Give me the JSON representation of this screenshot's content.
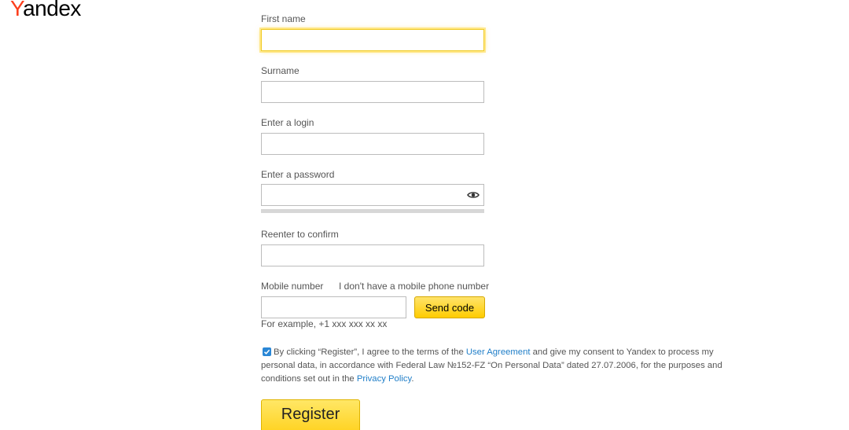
{
  "brand": {
    "logo_first": "Y",
    "logo_rest": "andex"
  },
  "form": {
    "first_name": {
      "label": "First name",
      "value": ""
    },
    "surname": {
      "label": "Surname",
      "value": ""
    },
    "login": {
      "label": "Enter a login",
      "value": ""
    },
    "password": {
      "label": "Enter a password",
      "value": "",
      "toggle_icon": "eye-icon"
    },
    "confirm": {
      "label": "Reenter to confirm",
      "value": ""
    },
    "mobile": {
      "label": "Mobile number",
      "no_phone_link": "I don't have a mobile phone number",
      "value": "",
      "send_code_label": "Send code",
      "hint": "For example, +1 xxx xxx xx xx"
    },
    "consent": {
      "checked": true,
      "text_1": "By clicking “Register”, I agree to the terms of the ",
      "link_1": "User Agreement",
      "text_2": " and give my consent to Yandex to process my",
      "text_3": "personal data, in accordance with Federal Law №152-FZ “On Personal Data” dated 27.07.2006, for the purposes and",
      "text_4": "conditions set out in the ",
      "link_2": "Privacy Policy",
      "text_5": "."
    },
    "register_label": "Register"
  },
  "colors": {
    "brand_red": "#fc3f1d",
    "accent_yellow": "#ffcc00",
    "link_blue": "#1f7ec8",
    "checkbox_blue": "#2a87d6"
  }
}
